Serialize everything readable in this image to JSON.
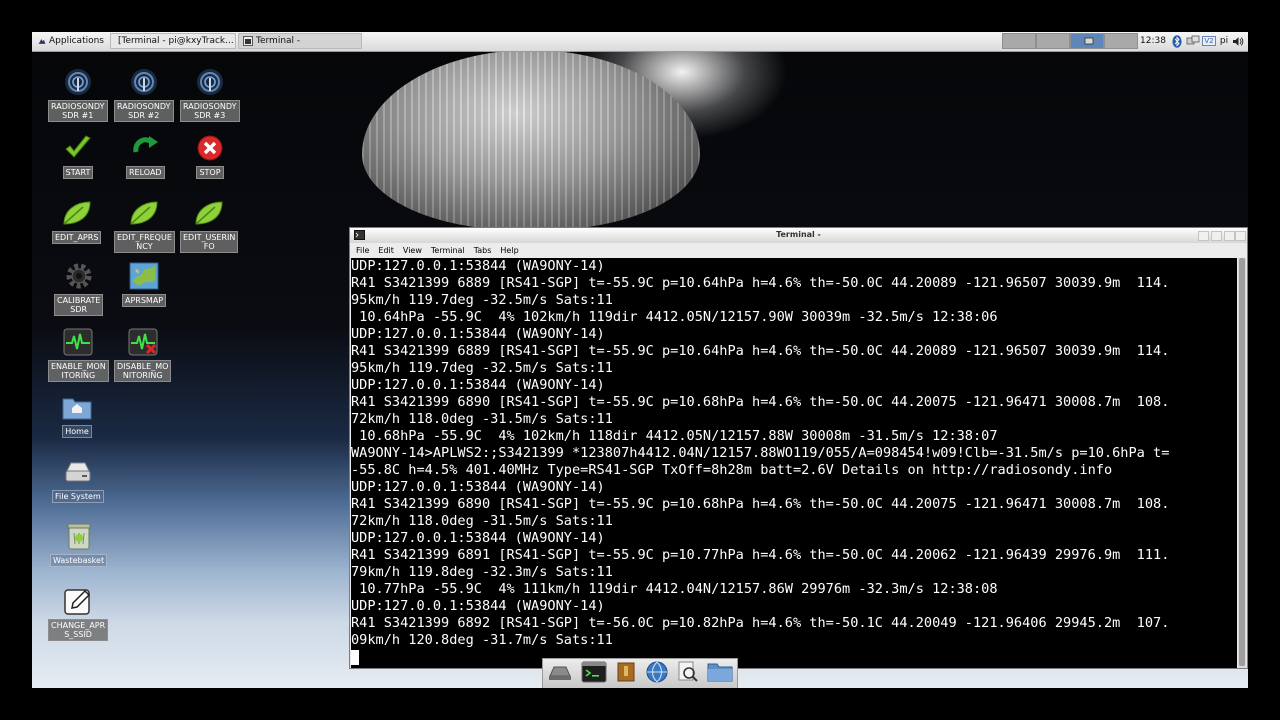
{
  "panel": {
    "applications": "Applications",
    "tasks": [
      "[Terminal - pi@kxyTrack...",
      "Terminal -"
    ],
    "clock": "12:38",
    "user": "pi",
    "v2_indicator": "V2"
  },
  "desktop": {
    "icons": [
      {
        "label": "RADIOSONDY\nSDR #1",
        "icon": "radio-antenna-icon"
      },
      {
        "label": "RADIOSONDY\nSDR #2",
        "icon": "radio-antenna-icon"
      },
      {
        "label": "RADIOSONDY\nSDR #3",
        "icon": "radio-antenna-icon"
      },
      {
        "label": "START",
        "icon": "checkmark-icon"
      },
      {
        "label": "RELOAD",
        "icon": "reload-icon"
      },
      {
        "label": "STOP",
        "icon": "stop-icon"
      },
      {
        "label": "EDIT_APRS",
        "icon": "edit-leaf-icon"
      },
      {
        "label": "EDIT_FREQUE\nNCY",
        "icon": "edit-leaf-icon"
      },
      {
        "label": "EDIT_USERIN\nFO",
        "icon": "edit-leaf-icon"
      },
      {
        "label": "CALIBRATE\nSDR",
        "icon": "gear-icon"
      },
      {
        "label": "APRSMAP",
        "icon": "map-icon"
      },
      {
        "label": "ENABLE_MON\nITORING",
        "icon": "monitor-pulse-icon"
      },
      {
        "label": "DISABLE_MO\nNITORING",
        "icon": "monitor-pulse-off-icon"
      },
      {
        "label": "Home",
        "icon": "home-folder-icon"
      },
      {
        "label": "File System",
        "icon": "drive-icon"
      },
      {
        "label": "Wastebasket",
        "icon": "trash-icon"
      },
      {
        "label": "CHANGE_APR\nS_SSID",
        "icon": "pencil-icon"
      }
    ]
  },
  "terminal": {
    "title": "Terminal -",
    "menu": [
      "File",
      "Edit",
      "View",
      "Terminal",
      "Tabs",
      "Help"
    ],
    "lines": [
      "UDP:127.0.0.1:53844 (WA9ONY-14)",
      "R41 S3421399 6889 [RS41-SGP] t=-55.9C p=10.64hPa h=4.6% th=-50.0C 44.20089 -121.96507 30039.9m  114.",
      "95km/h 119.7deg -32.5m/s Sats:11",
      " 10.64hPa -55.9C  4% 102km/h 119dir 4412.05N/12157.90W 30039m -32.5m/s 12:38:06",
      "UDP:127.0.0.1:53844 (WA9ONY-14)",
      "R41 S3421399 6889 [RS41-SGP] t=-55.9C p=10.64hPa h=4.6% th=-50.0C 44.20089 -121.96507 30039.9m  114.",
      "95km/h 119.7deg -32.5m/s Sats:11",
      "UDP:127.0.0.1:53844 (WA9ONY-14)",
      "R41 S3421399 6890 [RS41-SGP] t=-55.9C p=10.68hPa h=4.6% th=-50.0C 44.20075 -121.96471 30008.7m  108.",
      "72km/h 118.0deg -31.5m/s Sats:11",
      " 10.68hPa -55.9C  4% 102km/h 118dir 4412.05N/12157.88W 30008m -31.5m/s 12:38:07",
      "WA9ONY-14>APLWS2:;S3421399 *123807h4412.04N/12157.88WO119/055/A=098454!w09!Clb=-31.5m/s p=10.6hPa t=",
      "-55.8C h=4.5% 401.40MHz Type=RS41-SGP TxOff=8h28m batt=2.6V Details on http://radiosondy.info",
      "UDP:127.0.0.1:53844 (WA9ONY-14)",
      "R41 S3421399 6890 [RS41-SGP] t=-55.9C p=10.68hPa h=4.6% th=-50.0C 44.20075 -121.96471 30008.7m  108.",
      "72km/h 118.0deg -31.5m/s Sats:11",
      "UDP:127.0.0.1:53844 (WA9ONY-14)",
      "R41 S3421399 6891 [RS41-SGP] t=-55.9C p=10.77hPa h=4.6% th=-50.0C 44.20062 -121.96439 29976.9m  111.",
      "79km/h 119.8deg -32.3m/s Sats:11",
      " 10.77hPa -55.9C  4% 111km/h 119dir 4412.04N/12157.86W 29976m -32.3m/s 12:38:08",
      "UDP:127.0.0.1:53844 (WA9ONY-14)",
      "R41 S3421399 6892 [RS41-SGP] t=-56.0C p=10.82hPa h=4.6% th=-50.1C 44.20049 -121.96406 29945.2m  107.",
      "09km/h 120.8deg -31.7m/s Sats:11"
    ]
  },
  "dock": {
    "items": [
      "show-desktop-icon",
      "terminal-icon",
      "archive-icon",
      "web-browser-icon",
      "search-icon",
      "file-manager-icon"
    ]
  },
  "colors": {
    "terminal_bg": "#000000",
    "terminal_fg": "#ffffff",
    "workspace_active": "#5f86b8"
  }
}
